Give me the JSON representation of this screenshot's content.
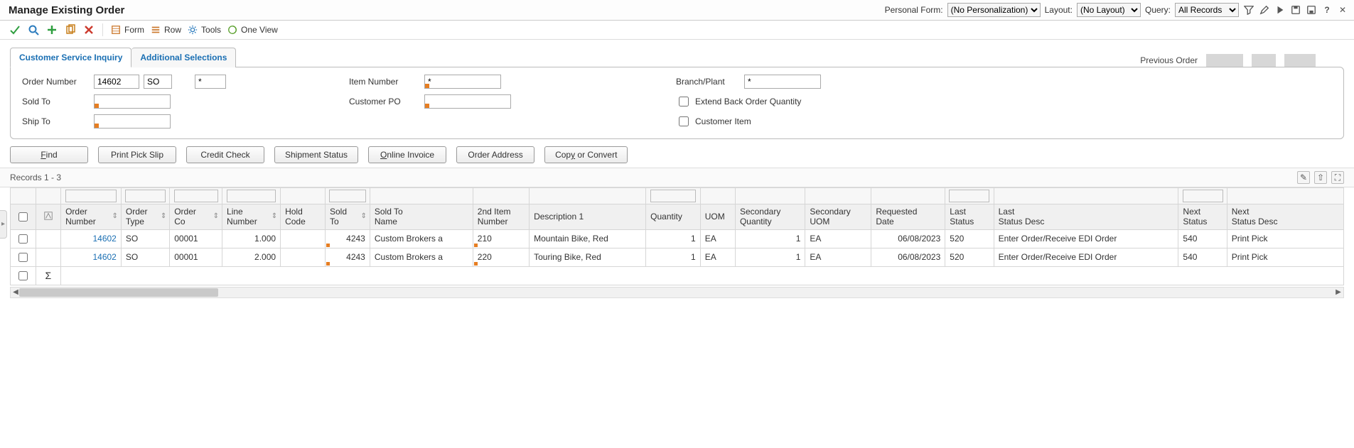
{
  "title": "Manage Existing Order",
  "header": {
    "personal_form_label": "Personal Form:",
    "personal_form_value": "(No Personalization)",
    "layout_label": "Layout:",
    "layout_value": "(No Layout)",
    "query_label": "Query:",
    "query_value": "All Records"
  },
  "toolbar": {
    "form": "Form",
    "row": "Row",
    "tools": "Tools",
    "one_view": "One View"
  },
  "tabs": {
    "csi": "Customer Service Inquiry",
    "additional": "Additional Selections"
  },
  "previous_order_label": "Previous Order",
  "form": {
    "order_number_label": "Order Number",
    "order_number": "14602",
    "order_type": "SO",
    "order_co": "*",
    "sold_to_label": "Sold To",
    "sold_to": "",
    "ship_to_label": "Ship To",
    "ship_to": "",
    "item_number_label": "Item Number",
    "item_number": "*",
    "customer_po_label": "Customer PO",
    "customer_po": "",
    "branch_plant_label": "Branch/Plant",
    "branch_plant": "*",
    "extend_back_order_label": "Extend Back Order Quantity",
    "customer_item_label": "Customer Item"
  },
  "buttons": {
    "find": "Find",
    "print_pick_slip": "Print Pick Slip",
    "credit_check": "Credit Check",
    "shipment_status": "Shipment Status",
    "online_invoice": "Online Invoice",
    "order_address": "Order Address",
    "copy_or_convert": "Copy or Convert"
  },
  "records_text": "Records 1 - 3",
  "columns": {
    "order_number": "Order\nNumber",
    "order_type": "Order\nType",
    "order_co": "Order\nCo",
    "line_number": "Line\nNumber",
    "hold_code": "Hold\nCode",
    "sold_to": "Sold\nTo",
    "sold_to_name": "Sold To\nName",
    "second_item": "2nd Item\nNumber",
    "description1": "Description 1",
    "quantity": "Quantity",
    "uom": "UOM",
    "secondary_qty": "Secondary\nQuantity",
    "secondary_uom": "Secondary\nUOM",
    "requested_date": "Requested\nDate",
    "last_status": "Last\nStatus",
    "last_status_desc": "Last\nStatus Desc",
    "next_status": "Next\nStatus",
    "next_status_desc": "Next\nStatus Desc"
  },
  "rows": [
    {
      "order_number": "14602",
      "order_type": "SO",
      "order_co": "00001",
      "line_number": "1.000",
      "hold_code": "",
      "sold_to": "4243",
      "sold_to_name": "Custom Brokers a",
      "second_item": "210",
      "description1": "Mountain Bike, Red",
      "quantity": "1",
      "uom": "EA",
      "secondary_qty": "1",
      "secondary_uom": "EA",
      "requested_date": "06/08/2023",
      "last_status": "520",
      "last_status_desc": "Enter Order/Receive EDI Order",
      "next_status": "540",
      "next_status_desc": "Print Pick"
    },
    {
      "order_number": "14602",
      "order_type": "SO",
      "order_co": "00001",
      "line_number": "2.000",
      "hold_code": "",
      "sold_to": "4243",
      "sold_to_name": "Custom Brokers a",
      "second_item": "220",
      "description1": "Touring Bike, Red",
      "quantity": "1",
      "uom": "EA",
      "secondary_qty": "1",
      "secondary_uom": "EA",
      "requested_date": "06/08/2023",
      "last_status": "520",
      "last_status_desc": "Enter Order/Receive EDI Order",
      "next_status": "540",
      "next_status_desc": "Print Pick"
    }
  ]
}
